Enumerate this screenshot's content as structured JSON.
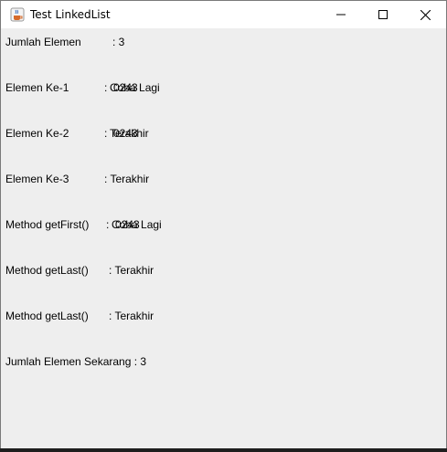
{
  "window": {
    "title": "Test LinkedList"
  },
  "icons": {
    "app": "java-cup-icon",
    "minimize": "minimize-icon",
    "maximize": "maximize-icon",
    "close": "close-icon"
  },
  "rows": [
    {
      "label": "Jumlah Elemen",
      "sep": ": 3"
    },
    {
      "label": "Elemen Ke-1",
      "sep": ":",
      "value": "Coba Lagi",
      "overlay": "0243"
    },
    {
      "label": "Elemen Ke-2",
      "sep": ":",
      "value": "Terakhir",
      "overlay": "0243"
    },
    {
      "label": "Elemen Ke-3",
      "sep": ": Terakhir"
    },
    {
      "label": "Method getFirst()",
      "sep": ":",
      "value": "Coba Lagi",
      "overlay": "0243"
    },
    {
      "label": "Method getLast()",
      "sep": ": Terakhir"
    },
    {
      "label": "Method getLast()",
      "sep": ": Terakhir"
    },
    {
      "label": "Jumlah Elemen Sekarang : 3"
    }
  ]
}
